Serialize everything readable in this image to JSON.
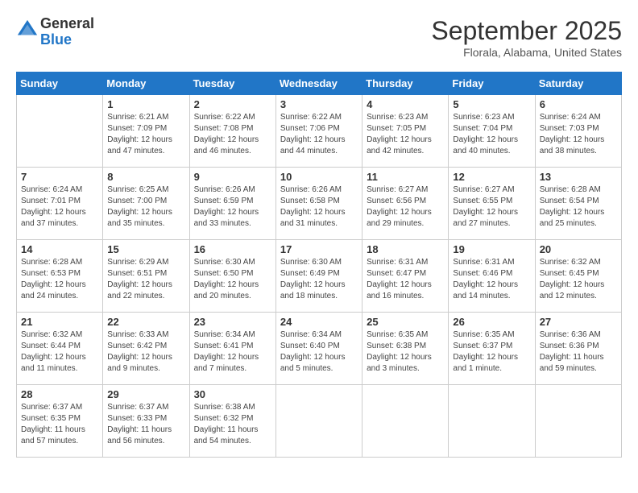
{
  "header": {
    "logo_general": "General",
    "logo_blue": "Blue",
    "month_title": "September 2025",
    "location": "Florala, Alabama, United States"
  },
  "days_of_week": [
    "Sunday",
    "Monday",
    "Tuesday",
    "Wednesday",
    "Thursday",
    "Friday",
    "Saturday"
  ],
  "weeks": [
    [
      {
        "day": "",
        "info": ""
      },
      {
        "day": "1",
        "info": "Sunrise: 6:21 AM\nSunset: 7:09 PM\nDaylight: 12 hours and 47 minutes."
      },
      {
        "day": "2",
        "info": "Sunrise: 6:22 AM\nSunset: 7:08 PM\nDaylight: 12 hours and 46 minutes."
      },
      {
        "day": "3",
        "info": "Sunrise: 6:22 AM\nSunset: 7:06 PM\nDaylight: 12 hours and 44 minutes."
      },
      {
        "day": "4",
        "info": "Sunrise: 6:23 AM\nSunset: 7:05 PM\nDaylight: 12 hours and 42 minutes."
      },
      {
        "day": "5",
        "info": "Sunrise: 6:23 AM\nSunset: 7:04 PM\nDaylight: 12 hours and 40 minutes."
      },
      {
        "day": "6",
        "info": "Sunrise: 6:24 AM\nSunset: 7:03 PM\nDaylight: 12 hours and 38 minutes."
      }
    ],
    [
      {
        "day": "7",
        "info": "Sunrise: 6:24 AM\nSunset: 7:01 PM\nDaylight: 12 hours and 37 minutes."
      },
      {
        "day": "8",
        "info": "Sunrise: 6:25 AM\nSunset: 7:00 PM\nDaylight: 12 hours and 35 minutes."
      },
      {
        "day": "9",
        "info": "Sunrise: 6:26 AM\nSunset: 6:59 PM\nDaylight: 12 hours and 33 minutes."
      },
      {
        "day": "10",
        "info": "Sunrise: 6:26 AM\nSunset: 6:58 PM\nDaylight: 12 hours and 31 minutes."
      },
      {
        "day": "11",
        "info": "Sunrise: 6:27 AM\nSunset: 6:56 PM\nDaylight: 12 hours and 29 minutes."
      },
      {
        "day": "12",
        "info": "Sunrise: 6:27 AM\nSunset: 6:55 PM\nDaylight: 12 hours and 27 minutes."
      },
      {
        "day": "13",
        "info": "Sunrise: 6:28 AM\nSunset: 6:54 PM\nDaylight: 12 hours and 25 minutes."
      }
    ],
    [
      {
        "day": "14",
        "info": "Sunrise: 6:28 AM\nSunset: 6:53 PM\nDaylight: 12 hours and 24 minutes."
      },
      {
        "day": "15",
        "info": "Sunrise: 6:29 AM\nSunset: 6:51 PM\nDaylight: 12 hours and 22 minutes."
      },
      {
        "day": "16",
        "info": "Sunrise: 6:30 AM\nSunset: 6:50 PM\nDaylight: 12 hours and 20 minutes."
      },
      {
        "day": "17",
        "info": "Sunrise: 6:30 AM\nSunset: 6:49 PM\nDaylight: 12 hours and 18 minutes."
      },
      {
        "day": "18",
        "info": "Sunrise: 6:31 AM\nSunset: 6:47 PM\nDaylight: 12 hours and 16 minutes."
      },
      {
        "day": "19",
        "info": "Sunrise: 6:31 AM\nSunset: 6:46 PM\nDaylight: 12 hours and 14 minutes."
      },
      {
        "day": "20",
        "info": "Sunrise: 6:32 AM\nSunset: 6:45 PM\nDaylight: 12 hours and 12 minutes."
      }
    ],
    [
      {
        "day": "21",
        "info": "Sunrise: 6:32 AM\nSunset: 6:44 PM\nDaylight: 12 hours and 11 minutes."
      },
      {
        "day": "22",
        "info": "Sunrise: 6:33 AM\nSunset: 6:42 PM\nDaylight: 12 hours and 9 minutes."
      },
      {
        "day": "23",
        "info": "Sunrise: 6:34 AM\nSunset: 6:41 PM\nDaylight: 12 hours and 7 minutes."
      },
      {
        "day": "24",
        "info": "Sunrise: 6:34 AM\nSunset: 6:40 PM\nDaylight: 12 hours and 5 minutes."
      },
      {
        "day": "25",
        "info": "Sunrise: 6:35 AM\nSunset: 6:38 PM\nDaylight: 12 hours and 3 minutes."
      },
      {
        "day": "26",
        "info": "Sunrise: 6:35 AM\nSunset: 6:37 PM\nDaylight: 12 hours and 1 minute."
      },
      {
        "day": "27",
        "info": "Sunrise: 6:36 AM\nSunset: 6:36 PM\nDaylight: 11 hours and 59 minutes."
      }
    ],
    [
      {
        "day": "28",
        "info": "Sunrise: 6:37 AM\nSunset: 6:35 PM\nDaylight: 11 hours and 57 minutes."
      },
      {
        "day": "29",
        "info": "Sunrise: 6:37 AM\nSunset: 6:33 PM\nDaylight: 11 hours and 56 minutes."
      },
      {
        "day": "30",
        "info": "Sunrise: 6:38 AM\nSunset: 6:32 PM\nDaylight: 11 hours and 54 minutes."
      },
      {
        "day": "",
        "info": ""
      },
      {
        "day": "",
        "info": ""
      },
      {
        "day": "",
        "info": ""
      },
      {
        "day": "",
        "info": ""
      }
    ]
  ]
}
